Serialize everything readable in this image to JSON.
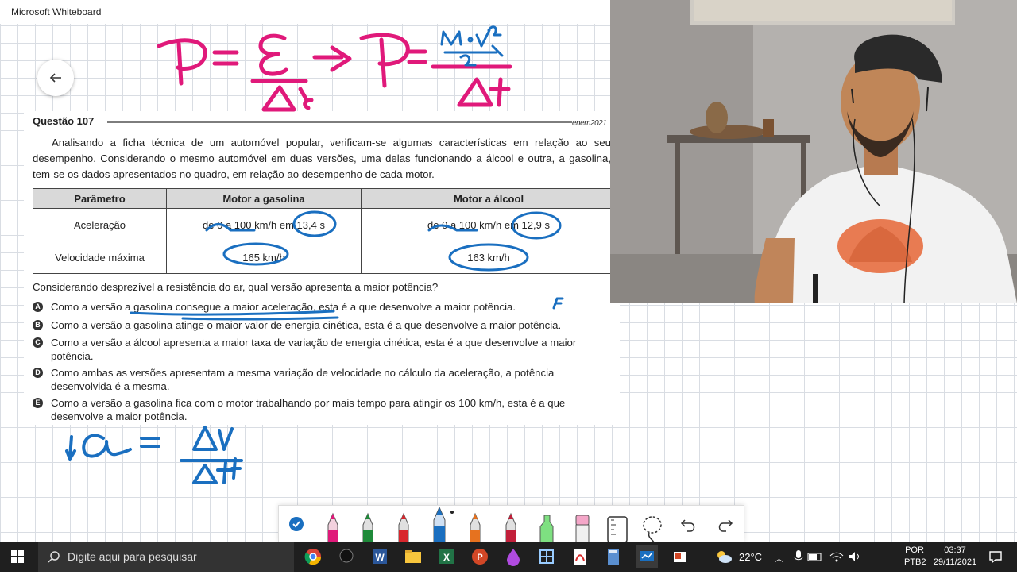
{
  "window": {
    "title": "Microsoft Whiteboard"
  },
  "question": {
    "title": "Questão 107",
    "source": "enem2021",
    "paragraph": "Analisando a ficha técnica de um automóvel popular, verificam-se algumas características em relação ao seu desempenho. Considerando o mesmo automóvel em duas versões, uma delas funcionando a álcool e outra, a gasolina, tem-se os dados apresentados no quadro, em relação ao desempenho de cada motor.",
    "table": {
      "headers": [
        "Parâmetro",
        "Motor a gasolina",
        "Motor a álcool"
      ],
      "rows": [
        [
          "Aceleração",
          "de 0 a 100 km/h em 13,4 s",
          "de 0 a 100 km/h em 12,9 s"
        ],
        [
          "Velocidade máxima",
          "165 km/h",
          "163 km/h"
        ]
      ]
    },
    "ask": "Considerando desprezível a resistência do ar, qual versão apresenta a maior potência?",
    "options": [
      {
        "letter": "A",
        "text": "Como a versão a gasolina consegue a maior aceleração, esta é a que desenvolve a maior potência."
      },
      {
        "letter": "B",
        "text": "Como a versão a gasolina atinge o maior valor de energia cinética, esta é a que desenvolve a maior potência."
      },
      {
        "letter": "C",
        "text": "Como a versão a álcool apresenta a maior taxa de variação de energia cinética, esta é a que desenvolve a maior potência."
      },
      {
        "letter": "D",
        "text": "Como ambas as versões apresentam a mesma variação de velocidade no cálculo da aceleração, a potência desenvolvida é a mesma."
      },
      {
        "letter": "E",
        "text": "Como a versão a gasolina fica com o motor trabalhando por mais tempo para atingir os 100 km/h, esta é a que desenvolve a maior potência."
      }
    ]
  },
  "ink": {
    "formula_top": {
      "p": "P",
      "eq": "=",
      "e": "E",
      "dt": "Δt",
      "arrow": "⇒",
      "m_v2": "m·v²",
      "two": "2"
    },
    "formula_bottom": {
      "a": "a",
      "eq": "=",
      "dv": "ΔV",
      "dt": "Δt"
    },
    "mark_false": "F",
    "colors": {
      "pink": "#e0197a",
      "blue": "#1a6fc0"
    }
  },
  "toolbar": {
    "tools": [
      "select-check",
      "pen-pink",
      "pen-green",
      "pen-red",
      "pen-blue",
      "pen-orange",
      "pen-red-2",
      "highlighter-green",
      "eraser-pink",
      "ruler",
      "lasso",
      "undo",
      "redo"
    ]
  },
  "taskbar": {
    "search_placeholder": "Digite aqui para pesquisar",
    "weather": "22°C",
    "language": "POR",
    "layout": "PTB2",
    "time": "03:37",
    "date": "29/11/2021"
  }
}
